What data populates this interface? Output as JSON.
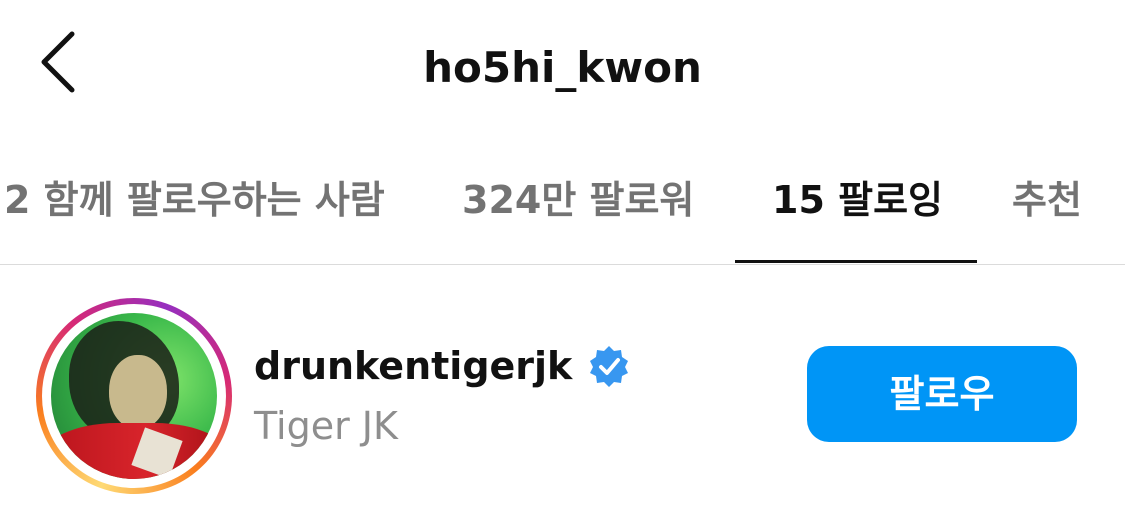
{
  "header": {
    "title": "ho5hi_kwon",
    "back_icon": "chevron-left-icon"
  },
  "tabs": [
    {
      "label": "2 함께 팔로우하는 사람",
      "active": false
    },
    {
      "label": "324만 팔로워",
      "active": false
    },
    {
      "label": "15 팔로잉",
      "active": true
    },
    {
      "label": "추천",
      "active": false
    }
  ],
  "list": [
    {
      "username": "drunkentigerjk",
      "full_name": "Tiger JK",
      "verified": true,
      "verified_icon": "verified-badge-icon",
      "has_story_ring": true,
      "button_label": "팔로우"
    }
  ],
  "colors": {
    "follow_button": "#0095f6",
    "verified_badge": "#3897f0",
    "active_tab": "#111111",
    "inactive_tab": "#737373",
    "secondary_text": "#8e8e8e"
  }
}
